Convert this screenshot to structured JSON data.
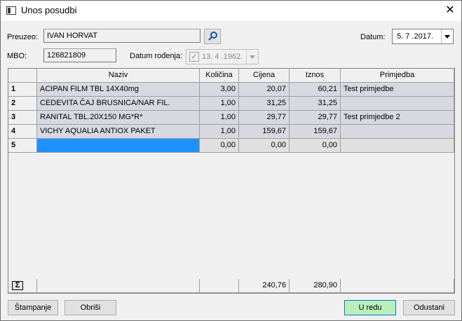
{
  "window": {
    "title": "Unos posudbi",
    "close_glyph": "✕"
  },
  "patient": {
    "preuzeo_label": "Preuzeo:",
    "preuzeo_value": "IVAN HORVAT",
    "mbo_label": "MBO:",
    "mbo_value": "126821809",
    "dob_label": "Datum rođenja:",
    "dob_value": "13. 4 .1962."
  },
  "datum": {
    "label": "Datum:",
    "value": "5. 7 .2017."
  },
  "table": {
    "columns": [
      "Naziv",
      "Količina",
      "Cijena",
      "Iznos",
      "Primjedba"
    ],
    "rows": [
      {
        "num": "1",
        "naziv": "ACIPAN FILM TBL 14X40mg",
        "kolicina": "3,00",
        "cijena": "20,07",
        "iznos": "60,21",
        "primjedba": "Test primjedbe"
      },
      {
        "num": "2",
        "naziv": "CEDEVITA ČAJ BRUSNICA/NAR FIL.",
        "kolicina": "1,00",
        "cijena": "31,25",
        "iznos": "31,25",
        "primjedba": ""
      },
      {
        "num": "3",
        "naziv": "RANITAL TBL.20X150 MG*R*",
        "kolicina": "1,00",
        "cijena": "29,77",
        "iznos": "29,77",
        "primjedba": "Test primjedbe 2"
      },
      {
        "num": "4",
        "naziv": "VICHY AQUALIA ANTIOX PAKET",
        "kolicina": "1,00",
        "cijena": "159,67",
        "iznos": "159,67",
        "primjedba": ""
      },
      {
        "num": "5",
        "naziv": "",
        "kolicina": "0,00",
        "cijena": "0,00",
        "iznos": "0,00",
        "primjedba": ""
      }
    ],
    "sum": {
      "icon_glyph": "Σ",
      "cijena": "240,76",
      "iznos": "280,90"
    }
  },
  "buttons": {
    "print": "Štampanje",
    "delete": "Obriši",
    "ok": "U redu",
    "cancel": "Odustani"
  }
}
